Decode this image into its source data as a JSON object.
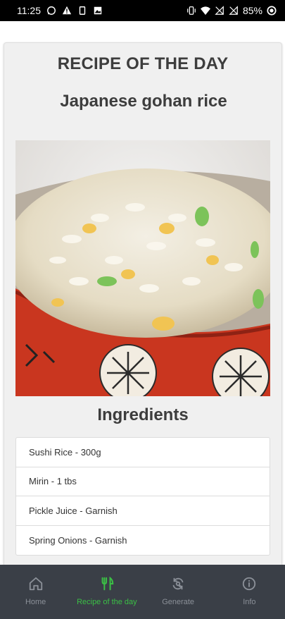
{
  "status_bar": {
    "time": "11:25",
    "battery": "85%"
  },
  "card": {
    "title": "RECIPE OF THE DAY",
    "recipe_name": "Japanese gohan rice",
    "image_icon": "fried-rice-bowl-photo",
    "ingredients_title": "Ingredients",
    "ingredients": [
      "Sushi Rice - 300g",
      "Mirin - 1 tbs",
      "Pickle Juice - Garnish",
      "Spring Onions - Garnish"
    ]
  },
  "bottom_nav": {
    "items": [
      {
        "label": "Home",
        "icon": "home-icon"
      },
      {
        "label": "Recipe of the day",
        "icon": "fork-knife-icon"
      },
      {
        "label": "Generate",
        "icon": "refresh-icon"
      },
      {
        "label": "Info",
        "icon": "info-icon"
      }
    ],
    "active_color": "#3bbf45",
    "inactive_color": "#8b9098"
  }
}
